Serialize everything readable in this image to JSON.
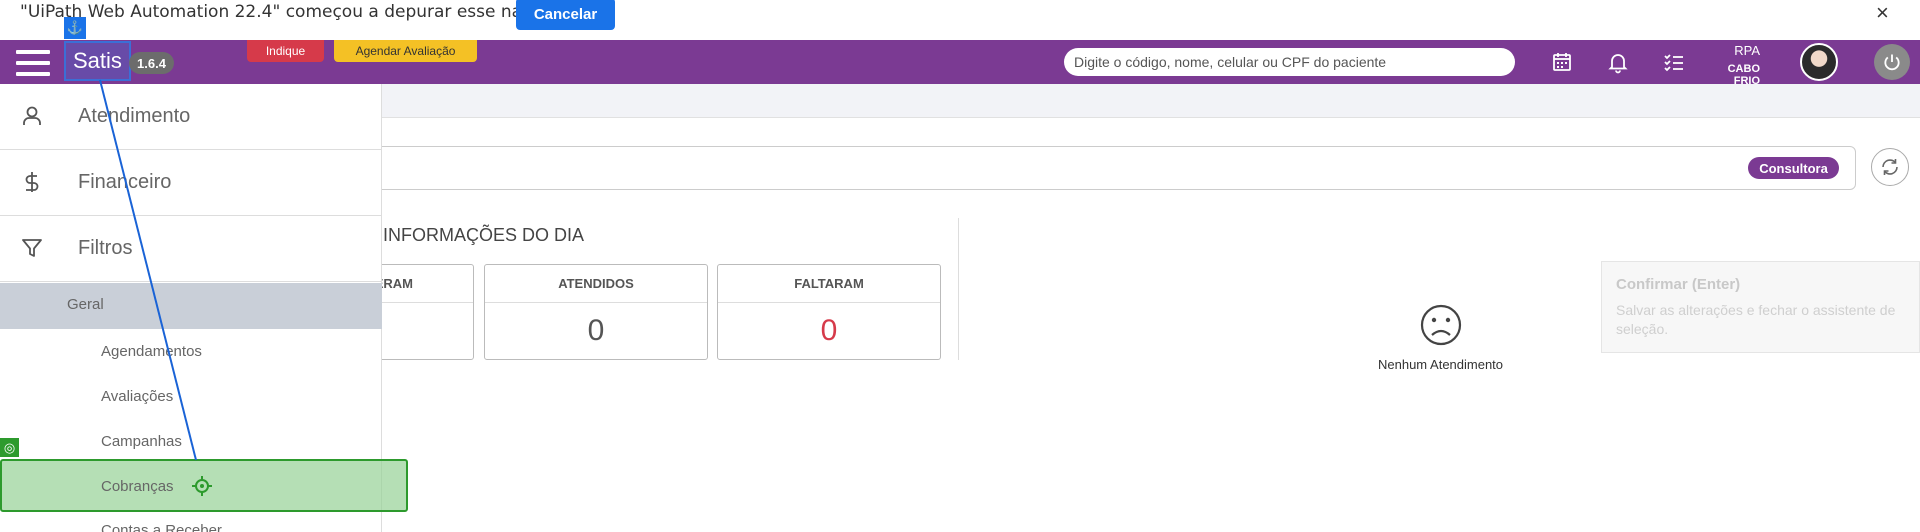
{
  "infobar": {
    "message": "\"UiPath Web Automation 22.4\" começou a depurar esse navegador",
    "cancel_label": "Cancelar",
    "close_icon": "×"
  },
  "header": {
    "brand": "Satis",
    "version": "1.6.4",
    "indique_label": "Indique",
    "agendar_label": "Agendar Avaliação",
    "search_placeholder": "Digite o código, nome, celular ou CPF do paciente",
    "user_name": "RPA",
    "user_city": "CABO FRIO",
    "brand_color": "#7b3a93"
  },
  "sidebar": {
    "items": [
      {
        "label": "Atendimento",
        "icon": "user-icon"
      },
      {
        "label": "Financeiro",
        "icon": "dollar-icon"
      },
      {
        "label": "Filtros",
        "icon": "filter-icon"
      }
    ],
    "group_label": "Geral",
    "sub_items": [
      "Agendamentos",
      "Avaliações",
      "Campanhas",
      "Cobranças",
      "Contas a Receber"
    ]
  },
  "main": {
    "consultora_badge": "Consultora",
    "info_title": "INFORMAÇÕES DO DIA",
    "stats": [
      {
        "label": "ERAM",
        "value": ""
      },
      {
        "label": "ATENDIDOS",
        "value": "0"
      },
      {
        "label": "FALTARAM",
        "value": "0"
      }
    ],
    "empty_text": "Nenhum Atendimento"
  },
  "tooltip": {
    "title": "Confirmar (Enter)",
    "description": "Salvar as alterações e fechar o assistente de seleção."
  }
}
